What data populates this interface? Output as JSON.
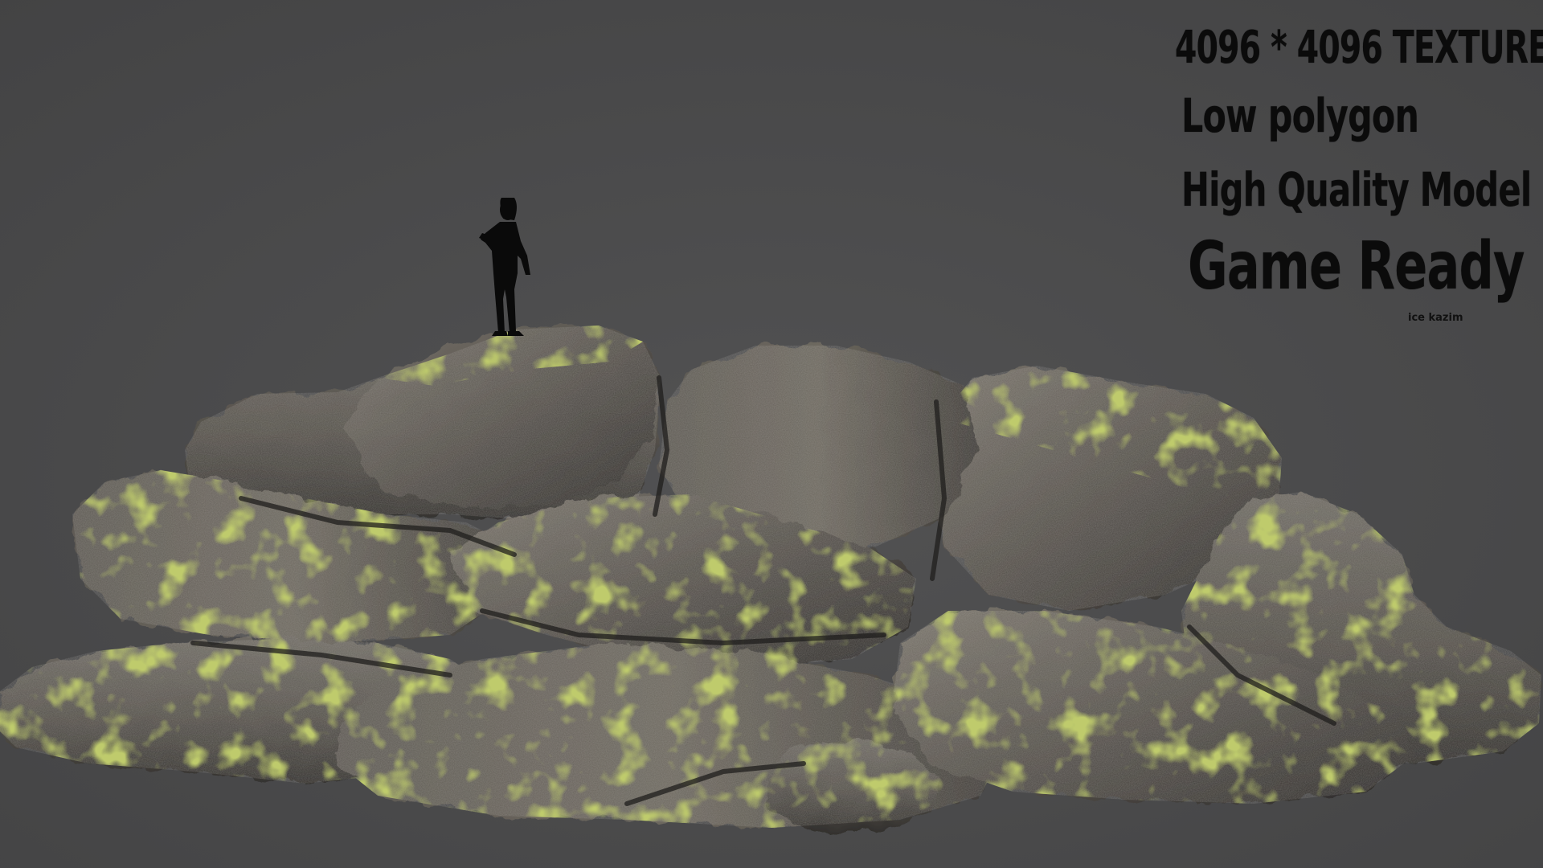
{
  "overlay": {
    "texture_spec": "4096 * 4096 TEXTURE",
    "poly_spec": "Low polygon",
    "quality_spec": "High Quality Model",
    "ready_spec": "Game Ready",
    "credit": "ice kazim"
  },
  "colors": {
    "background": "#4a4a4b",
    "rock_dark": "#3a3936",
    "rock_mid": "#5b5853",
    "rock_light": "#777168",
    "moss": "#7f8f2a",
    "moss_bright": "#9aa632",
    "silhouette": "#0a0a0a",
    "text": "#0b0b0b"
  },
  "icons": {
    "figure": "human-scale-silhouette"
  }
}
